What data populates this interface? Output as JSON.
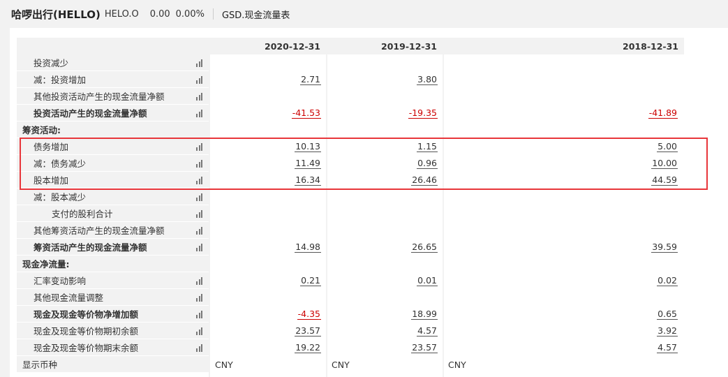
{
  "header": {
    "title": "哈啰出行(HELLO)",
    "code": "HELO.O",
    "price": "0.00",
    "change": "0.00%",
    "report": "GSD.现金流量表"
  },
  "columns": [
    "2020-12-31",
    "2019-12-31",
    "2018-12-31"
  ],
  "rows": [
    {
      "label": "投资减少",
      "values": [
        "",
        "",
        ""
      ]
    },
    {
      "label": "减：投资增加",
      "values": [
        "2.71",
        "3.80",
        ""
      ]
    },
    {
      "label": "其他投资活动产生的现金流量净额",
      "values": [
        "",
        "",
        ""
      ]
    },
    {
      "label": "投资活动产生的现金流量净额",
      "values": [
        "-41.53",
        "-19.35",
        "-41.89"
      ]
    },
    {
      "label": "筹资活动:",
      "values": [
        "",
        "",
        ""
      ]
    },
    {
      "label": "债务增加",
      "values": [
        "10.13",
        "1.15",
        "5.00"
      ]
    },
    {
      "label": "减：债务减少",
      "values": [
        "11.49",
        "0.96",
        "10.00"
      ]
    },
    {
      "label": "股本增加",
      "values": [
        "16.34",
        "26.46",
        "44.59"
      ]
    },
    {
      "label": "减：股本减少",
      "values": [
        "",
        "",
        ""
      ]
    },
    {
      "label": "支付的股利合计",
      "values": [
        "",
        "",
        ""
      ]
    },
    {
      "label": "其他筹资活动产生的现金流量净额",
      "values": [
        "",
        "",
        ""
      ]
    },
    {
      "label": "筹资活动产生的现金流量净额",
      "values": [
        "14.98",
        "26.65",
        "39.59"
      ]
    },
    {
      "label": "现金净流量:",
      "values": [
        "",
        "",
        ""
      ]
    },
    {
      "label": "汇率变动影响",
      "values": [
        "0.21",
        "0.01",
        "0.02"
      ]
    },
    {
      "label": "其他现金流量调整",
      "values": [
        "",
        "",
        ""
      ]
    },
    {
      "label": "现金及现金等价物净增加额",
      "values": [
        "-4.35",
        "18.99",
        "0.65"
      ]
    },
    {
      "label": "现金及现金等价物期初余额",
      "values": [
        "23.57",
        "4.57",
        "3.92"
      ]
    },
    {
      "label": "现金及现金等价物期末余额",
      "values": [
        "19.22",
        "23.57",
        "4.57"
      ]
    }
  ],
  "currency": {
    "label": "显示币种",
    "values": [
      "CNY",
      "CNY",
      "CNY"
    ]
  },
  "colors": {
    "negative": "#cc0000",
    "highlight_border": "#e8353a",
    "label_bg": "#f2f2f2"
  }
}
